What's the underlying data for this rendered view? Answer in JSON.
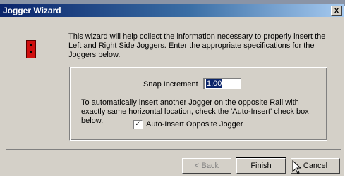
{
  "window": {
    "title": "Jogger Wizard",
    "close_glyph": "x"
  },
  "intro": "This wizard will help collect the information necessary to properly insert the Left and Right Side Joggers.  Enter the appropriate specifications for the Joggers below.",
  "snap": {
    "label": "Snap Increment",
    "value": "1.00"
  },
  "auto_insert": {
    "text": "To automatically insert another Jogger on the opposite Rail with exactly same horizontal location, check the 'Auto-Insert' check box below.",
    "checkbox_label": "Auto-Insert Opposite Jogger",
    "checked": true,
    "check_glyph": "✓"
  },
  "buttons": {
    "back": "< Back",
    "finish": "Finish",
    "cancel": "Cancel"
  },
  "icons": {
    "wizard": "jogger-icon",
    "cursor": "mouse-pointer-icon"
  }
}
